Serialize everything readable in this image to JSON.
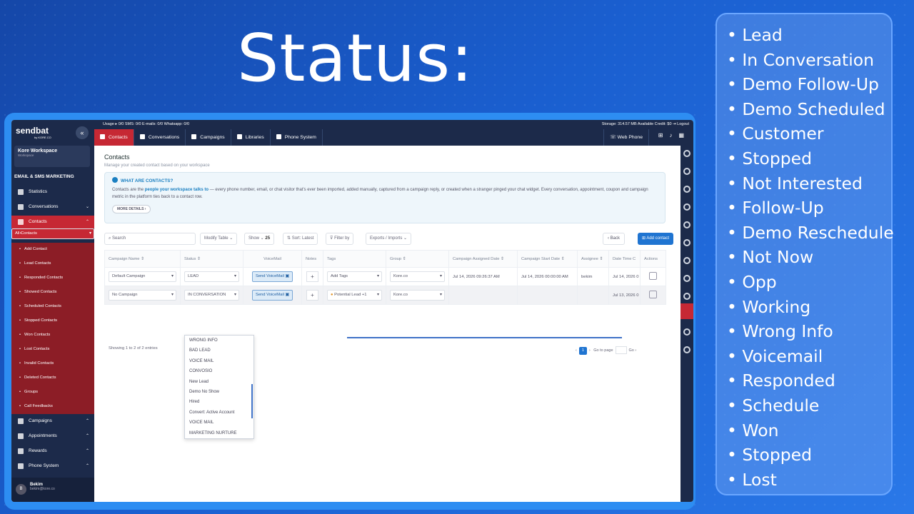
{
  "title": "Status:",
  "statuses": [
    "Lead",
    "In Conversation",
    "Demo Follow-Up",
    "Demo Scheduled",
    "Customer",
    "Stopped",
    "Not Interested",
    "Follow-Up",
    "Demo Reschedule",
    "Not Now",
    "Opp",
    "Working",
    "Wrong Info",
    "Voicemail",
    "Responded",
    "Schedule",
    "Won",
    "Stopped",
    "Lost"
  ],
  "app": {
    "logo": "sendbat",
    "logo_sub": "by KORE.CO",
    "workspace": {
      "name": "Kore Workspace",
      "sub": "Workspace"
    },
    "section": "EMAIL & SMS MARKETING",
    "nav": {
      "statistics": "Statistics",
      "conversations": "Conversations",
      "contacts": "Contacts",
      "campaigns": "Campaigns",
      "appointments": "Appointments",
      "rewards": "Rewards",
      "phone_system": "Phone System"
    },
    "contact_sub": [
      "All Contacts",
      "Add Contact",
      "Lead Contacts",
      "Responded Contacts",
      "Showed Contacts",
      "Scheduled Contacts",
      "Stopped Contacts",
      "Won Contacts",
      "Lost Contacts",
      "Invalid Contacts",
      "Deleted Contacts",
      "Groups",
      "Call Feedbacks"
    ],
    "user": {
      "initial": "B",
      "name": "Bekim",
      "email": "bekim@kore.co"
    },
    "usage": "Usage ▸  0/0  SMS: 0/0  E-mails: 0/0  Whatsapp: 0/0",
    "storage": "Storage: 314.57 MB   Available Credit: $0   ⇥ Logout",
    "tabs": [
      "Contacts",
      "Conversations",
      "Campaigns",
      "Libraries",
      "Phone System"
    ],
    "web_phone": "Web Phone",
    "page_title": "Contacts",
    "page_sub": "Manage your created contact based on your workspace",
    "info": {
      "title": "WHAT ARE CONTACTS?",
      "pre": "Contacts are the ",
      "bold": "people your workspace talks to",
      "post": " — every phone number, email, or chat visitor that's ever been imported, added manually, captured from a campaign reply, or created when a stranger pinged your chat widget. Every conversation, appointment, coupon and campaign metric in the platform ties back to a contact row.",
      "more": "MORE DETAILS"
    },
    "toolbar": {
      "search": "Search",
      "modify": "Modify Table",
      "show": "Show",
      "show_val": "25",
      "sort": "Sort: Latest",
      "filter": "Filter by",
      "export": "Exports / Imports",
      "back": "Back",
      "add": "Add contact"
    },
    "columns": [
      "Campaign Name",
      "Status",
      "VoiceMail",
      "Notes",
      "Tags",
      "Group",
      "Campaign Assigned Date",
      "Campaign Start Date",
      "Assignee",
      "Date Time C",
      "Actions"
    ],
    "rows": [
      {
        "campaign": "Default Campaign",
        "status": "LEAD",
        "vm": "Send VoiceMail",
        "tags": "Add Tags",
        "group": "Kore.co",
        "assigned": "Jul 14, 2026 09:26:37 AM",
        "start": "Jul 14, 2026 00:00:00 AM",
        "assignee": "bekim",
        "dt": "Jul 14, 2026 0"
      },
      {
        "campaign": "No Campaign",
        "status": "IN CONVERSATION",
        "vm": "Send VoiceMail",
        "tags": "Potential Lead",
        "tags_more": "+1",
        "group": "Kore.co",
        "assigned": "",
        "start": "",
        "assignee": "",
        "dt": "Jul 13, 2026 0"
      }
    ],
    "dropdown": [
      "WRONG INFO",
      "BAD LEAD",
      "VOICE MAIL",
      "CONVOSIO",
      "New Lead",
      "Demo No Show",
      "Hired",
      "Convert: Active Account",
      "VOICE MAIL",
      "MARKETING NURTURE"
    ],
    "entries": "Showing 1 to 2 of 2 entries",
    "page": "1",
    "goto": "Go to page",
    "go": "Go ›"
  }
}
